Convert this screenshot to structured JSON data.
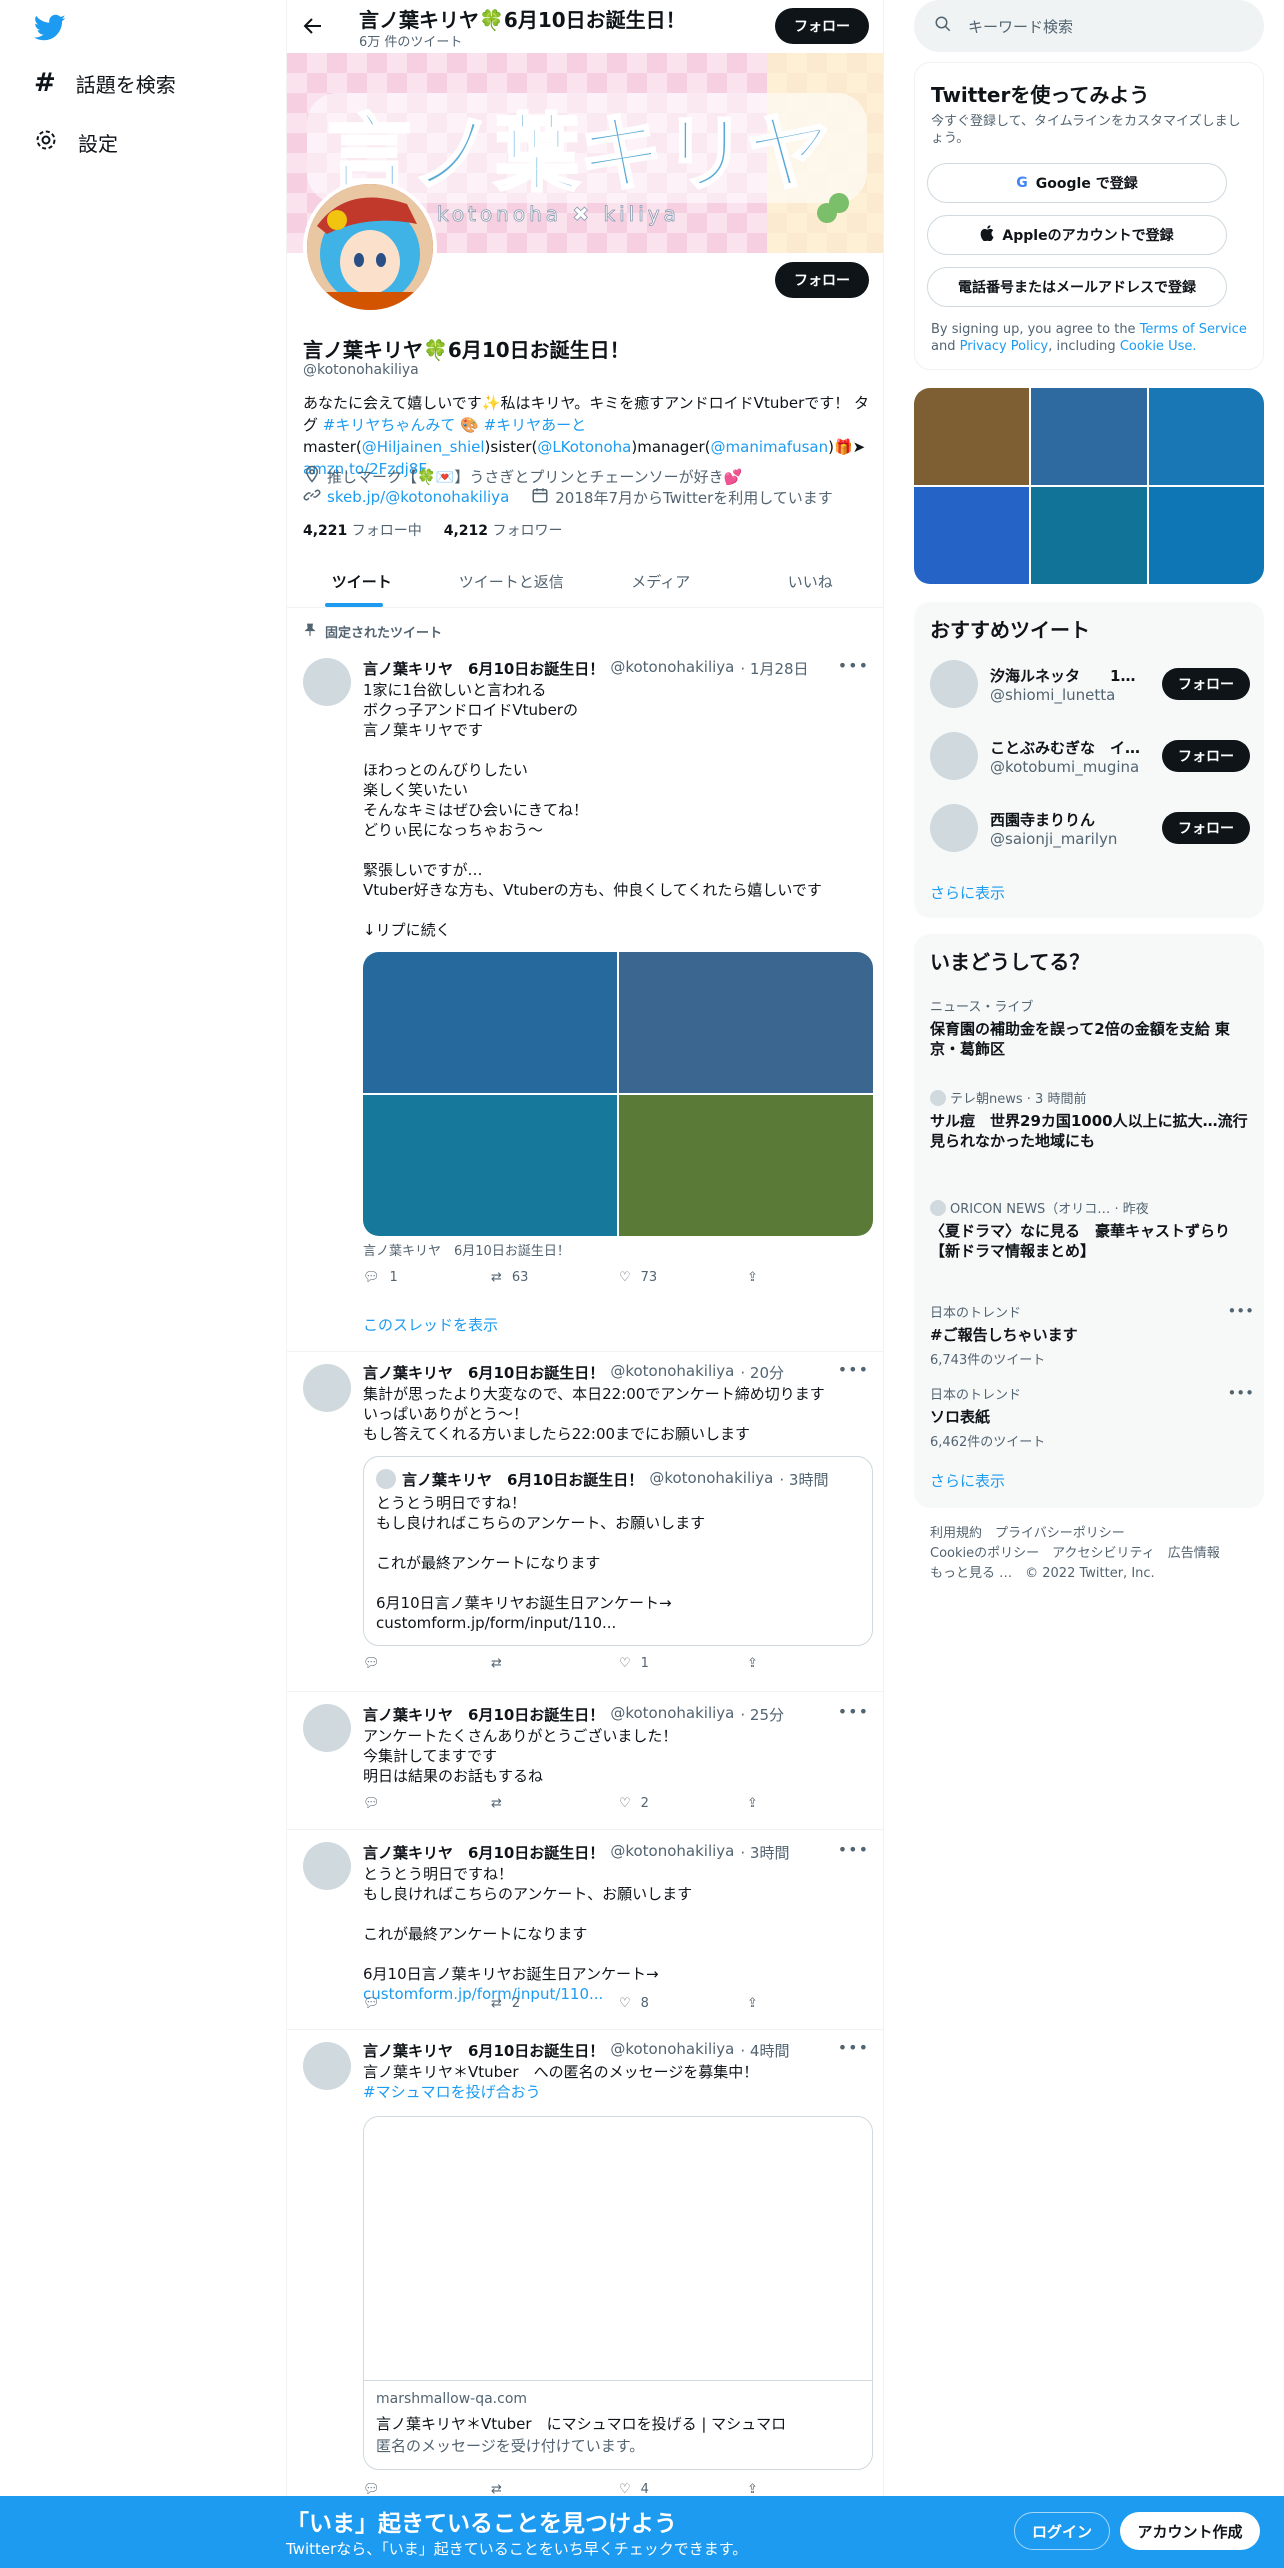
{
  "nav": {
    "explore_label": "話題を検索",
    "settings_label": "設定"
  },
  "profile": {
    "header_name": "言ノ葉キリヤ🍀6月10日お誕生日！",
    "tweet_count": "6万 件のツイート",
    "follow_label": "フォロー",
    "banner_title": "言ノ葉キリヤ",
    "banner_sub": "kotonoha ✖ kiliya",
    "name": "言ノ葉キリヤ🍀6月10日お誕生日！",
    "handle": "@kotonohakiliya",
    "bio_text_1": "あなたに会えて嬉しいです✨私はキリヤ。キミを癒すアンドロイドVtuberです！ タグ ",
    "bio_tag_1": "#キリヤちゃんみて",
    "bio_text_2": " 🎨 ",
    "bio_tag_2": "#キリヤあーと",
    "bio_text_3": " master(",
    "bio_mention_1": "@Hiljainen_shiel",
    "bio_text_4": ")sister(",
    "bio_mention_2": "@LKotonoha",
    "bio_text_5": ")manager(",
    "bio_mention_3": "@manimafusan",
    "bio_text_6": ")🎁➤ ",
    "bio_link": "amzn.to/2Fzdj8F",
    "location": "推しマーク【🍀💌】うさぎとプリンとチェーンソーが好き💕",
    "website": "skeb.jp/@kotonohakiliya",
    "joined": "2018年7月からTwitterを利用しています",
    "following_count": "4,221",
    "following_label": "フォロー中",
    "followers_count": "4,212",
    "followers_label": "フォロワー"
  },
  "tabs": [
    "ツイート",
    "ツイートと返信",
    "メディア",
    "いいね"
  ],
  "pinned_label": "固定されたツイート",
  "tweets": [
    {
      "name": "言ノ葉キリヤ　6月10日お誕生日！",
      "handle": "@kotonohakiliya",
      "time": "· 1月28日",
      "text": "1家に1台欲しいと言われる\nボクっ子アンドロイドVtuberの\n言ノ葉キリヤです\n\nほわっとのんびりしたい\n楽しく笑いたい\nそんなキミはぜひ会いにきてね！\nどりぃ民になっちゃおう～\n\n緊張しいですが…\nVtuber好きな方も、Vtuberの方も、仲良くしてくれたら嬉しいです\n\n↓リプに続く",
      "media_caption": "言ノ葉キリヤ　6月10日お誕生日！",
      "replies": "1",
      "retweets": "63",
      "likes": "73",
      "thread_label": "このスレッドを表示"
    },
    {
      "name": "言ノ葉キリヤ　6月10日お誕生日！",
      "handle": "@kotonohakiliya",
      "time": "· 20分",
      "text": "集計が思ったより大変なので、本日22:00でアンケート締め切ります\nいっぱいありがとう～！\nもし答えてくれる方いましたら22:00までにお願いします",
      "quote_name": "言ノ葉キリヤ　6月10日お誕生日！",
      "quote_handle": "@kotonohakiliya",
      "quote_time": "· 3時間",
      "quote_text": "とうとう明日ですね！\nもし良ければこちらのアンケート、お願いします\n\nこれが最終アンケートになります\n\n6月10日言ノ葉キリヤお誕生日アンケート→\ncustomform.jp/form/input/110...",
      "replies": "",
      "retweets": "",
      "likes": "1"
    },
    {
      "name": "言ノ葉キリヤ　6月10日お誕生日！",
      "handle": "@kotonohakiliya",
      "time": "· 25分",
      "text": "アンケートたくさんありがとうございました！\n今集計してますです\n明日は結果のお話もするね",
      "replies": "",
      "retweets": "",
      "likes": "2"
    },
    {
      "name": "言ノ葉キリヤ　6月10日お誕生日！",
      "handle": "@kotonohakiliya",
      "time": "· 3時間",
      "text": "とうとう明日ですね！\nもし良ければこちらのアンケート、お願いします\n\nこれが最終アンケートになります\n\n6月10日言ノ葉キリヤお誕生日アンケート→ ",
      "link": "customform.jp/form/input/110...",
      "replies": "",
      "retweets": "2",
      "likes": "8"
    },
    {
      "name": "言ノ葉キリヤ　6月10日お誕生日！",
      "handle": "@kotonohakiliya",
      "time": "· 4時間",
      "text": "言ノ葉キリヤ＊Vtuber　への匿名のメッセージを募集中！",
      "hashtag": "#マシュマロを投げ合おう",
      "card_domain": "marshmallow-qa.com",
      "card_title": "言ノ葉キリヤ＊Vtuber　にマシュマロを投げる | マシュマロ",
      "card_desc": "匿名のメッセージを受け付けています。",
      "likes": "4"
    }
  ],
  "right": {
    "search_placeholder": "キーワード検索",
    "signup_title": "Twitterを使ってみよう",
    "signup_sub": "今すぐ登録して、タイムラインをカスタマイズしましょう。",
    "google_btn": "Google で登録",
    "apple_btn": "Appleのアカウントで登録",
    "phone_btn": "電話番号またはメールアドレスで登録",
    "terms_1": "By signing up, you agree to the ",
    "terms_link": "Terms of Service",
    "terms_2": " and ",
    "privacy_link": "Privacy Policy",
    "terms_3": ", including ",
    "cookie_link": "Cookie Use.",
    "rec_title": "おすすめツイート",
    "recs": [
      {
        "name": "汐海ルネッタ　　1…",
        "handle": "@shiomi_lunetta",
        "btn": "フォロー"
      },
      {
        "name": "ことぶみむぎな　イ…",
        "handle": "@kotobumi_mugina",
        "btn": "フォロー"
      },
      {
        "name": "西園寺まりりん",
        "handle": "@saionji_marilyn",
        "btn": "フォロー"
      }
    ],
    "show_more": "さらに表示",
    "trend_title": "いまどうしてる？",
    "trends": [
      {
        "cat": "ニュース・ライブ",
        "title": "保育園の補助金を誤って2倍の金額を支給 東京・葛飾区",
        "sub": ""
      },
      {
        "cat": "テレ朝news · 3 時間前",
        "title": "サル痘　世界29カ国1000人以上に拡大…流行見られなかった地域にも",
        "sub": ""
      },
      {
        "cat": "ORICON NEWS（オリコ… · 昨夜",
        "title": "〈夏ドラマ〉なに見る　豪華キャストずらり【新ドラマ情報まとめ】",
        "sub": ""
      },
      {
        "cat": "日本のトレンド",
        "title": "#ご報告しちゃいます",
        "sub": "6,743件のツイート"
      },
      {
        "cat": "日本のトレンド",
        "title": "ソロ表紙",
        "sub": "6,462件のツイート"
      }
    ],
    "trend_more": "さらに表示",
    "footer_1": "利用規約　プライバシーポリシー",
    "footer_2": "Cookieのポリシー　アクセシビリティ　広告情報",
    "footer_3": "もっと見る …　© 2022 Twitter, Inc."
  },
  "bottom": {
    "title": "「いま」起きていることを見つけよう",
    "sub": "Twitterなら、「いま」起きていることをいち早くチェックできます。",
    "login": "ログイン",
    "signup": "アカウント作成"
  },
  "colors": {
    "accent": "#1d9bf0",
    "dark": "#0f1419",
    "muted": "#536471"
  }
}
